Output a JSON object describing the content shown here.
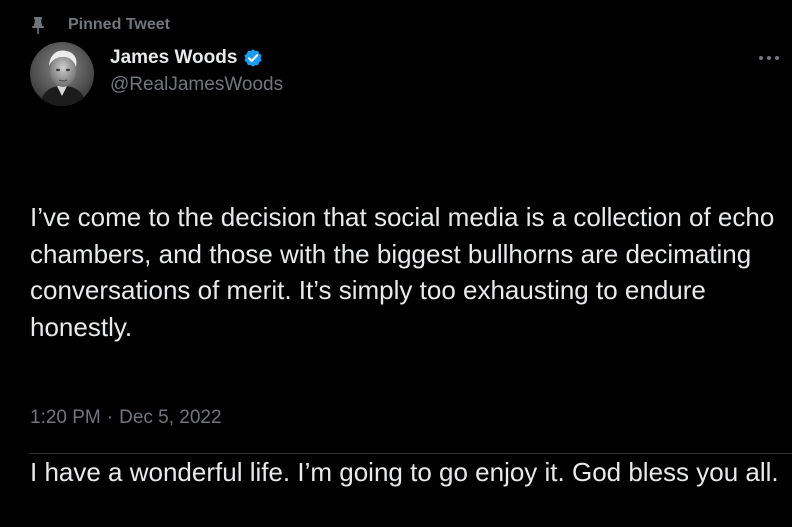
{
  "pinned": {
    "label": "Pinned Tweet",
    "icon": "pin-icon"
  },
  "author": {
    "display_name": "James Woods",
    "handle": "@RealJamesWoods",
    "verified_icon": "verified-badge-icon",
    "verified_color": "#1d9bf0"
  },
  "tweet": {
    "paragraphs": [
      "I’ve come to the decision that social media is a collection of echo chambers, and those with the biggest bullhorns are decimating conversations of merit. It’s simply too exhausting to endure honestly.",
      "I have a wonderful life. I’m going to go enjoy it. God bless you all."
    ],
    "time": "1:20 PM",
    "separator": "·",
    "date": "Dec 5, 2022"
  },
  "more_menu": {
    "icon": "more-options-icon",
    "glyph": "···"
  },
  "colors": {
    "background": "#000000",
    "primary_text": "#e7e9ea",
    "secondary_text": "#71767b",
    "divider": "#2f3336"
  }
}
